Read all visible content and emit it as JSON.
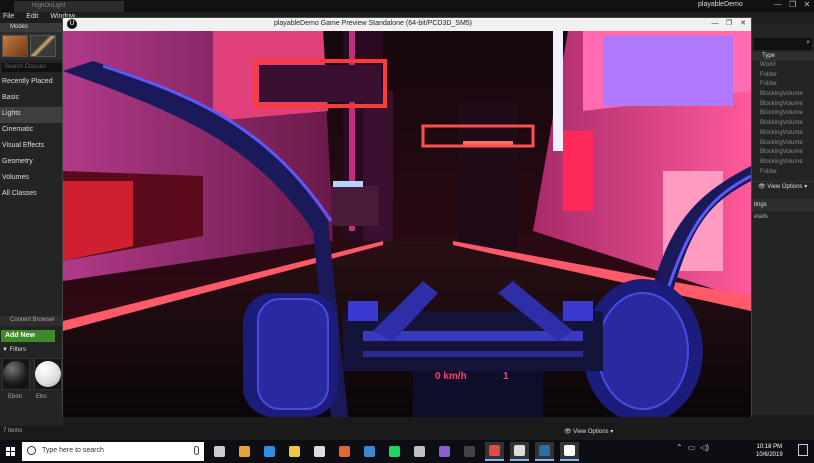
{
  "editor": {
    "tab_label": "HighOnLight",
    "project_tab": "playableDemo",
    "window_buttons": [
      "—",
      "❐",
      "✕"
    ]
  },
  "menu": {
    "items": [
      "File",
      "Edit",
      "Window"
    ]
  },
  "modes": {
    "title": "Modes",
    "search_placeholder": "Search Classes",
    "categories": [
      "Recently Placed",
      "Basic",
      "Lights",
      "Cinematic",
      "Visual Effects",
      "Geometry",
      "Volumes",
      "All Classes"
    ],
    "selected": "Lights"
  },
  "content_browser": {
    "title": "Content Browser",
    "add_new": "Add New",
    "filters": "Filters",
    "assets": [
      "Ebon",
      "Ebo"
    ],
    "items_count": "7 items",
    "view_options": "View Options"
  },
  "outliner": {
    "type_header": "Type",
    "rows": [
      "World",
      "Folder",
      "Folder",
      "BlockingVolume",
      "BlockingVolume",
      "BlockingVolume",
      "BlockingVolume",
      "BlockingVolume",
      "BlockingVolume",
      "BlockingVolume",
      "BlockingVolume",
      "Folder"
    ],
    "view_options": "View Options",
    "details_tab": "tings",
    "details_sub": "etails"
  },
  "preview": {
    "title": "playableDemo Game Preview Standalone (64-bit/PCD3D_SM5)",
    "buttons": [
      "—",
      "❐",
      "✕"
    ],
    "speed": "0 km/h",
    "gear": "1"
  },
  "taskbar": {
    "search_placeholder": "Type here to search",
    "time": "10:18 PM",
    "date": "10/6/2019",
    "apps": [
      {
        "name": "task-view-icon",
        "color": "#cccccc"
      },
      {
        "name": "chrome-icon",
        "color": "#e8a23a"
      },
      {
        "name": "edge-icon",
        "color": "#2f8fe0"
      },
      {
        "name": "file-explorer-icon",
        "color": "#f2c744"
      },
      {
        "name": "mail-icon",
        "color": "#dddddd"
      },
      {
        "name": "settings-icon",
        "color": "#e3672e"
      },
      {
        "name": "media-icon",
        "color": "#3a8ad0"
      },
      {
        "name": "spotify-icon",
        "color": "#1ed760"
      },
      {
        "name": "app-icon",
        "color": "#c0c0c0"
      },
      {
        "name": "visual-studio-icon",
        "color": "#8e5cd6"
      },
      {
        "name": "terminal-icon",
        "color": "#444444"
      },
      {
        "name": "snip-icon",
        "color": "#e24a4a"
      },
      {
        "name": "ue-launcher-icon",
        "color": "#dddddd"
      },
      {
        "name": "steam-icon",
        "color": "#2a6fa8"
      },
      {
        "name": "unreal-editor-icon",
        "color": "#ffffff"
      }
    ]
  },
  "colors": {
    "hud": "#ff3d6a",
    "neon_pink": "#ff2d88",
    "neon_blue": "#3a3aff",
    "accent_green": "#3d8a2a"
  }
}
